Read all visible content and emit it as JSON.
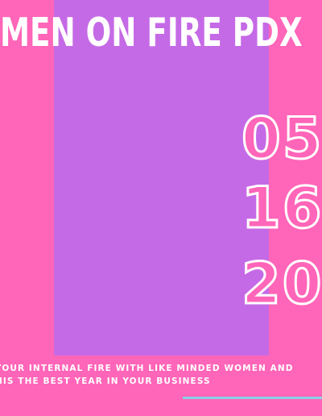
{
  "poster": {
    "title": "MEN ON FIRE PDX",
    "date": {
      "month": "05",
      "day": "16",
      "year": "20"
    },
    "tagline_line1": "YOUR INTERNAL FIRE WITH LIKE MINDED WOMEN AND",
    "tagline_line2": "HIS THE BEST YEAR IN YOUR BUSINESS"
  },
  "colors": {
    "background": "#ff65b8",
    "panel": "#c56ae6",
    "text": "#ffffff",
    "accent_line": "#8ad0e6"
  }
}
